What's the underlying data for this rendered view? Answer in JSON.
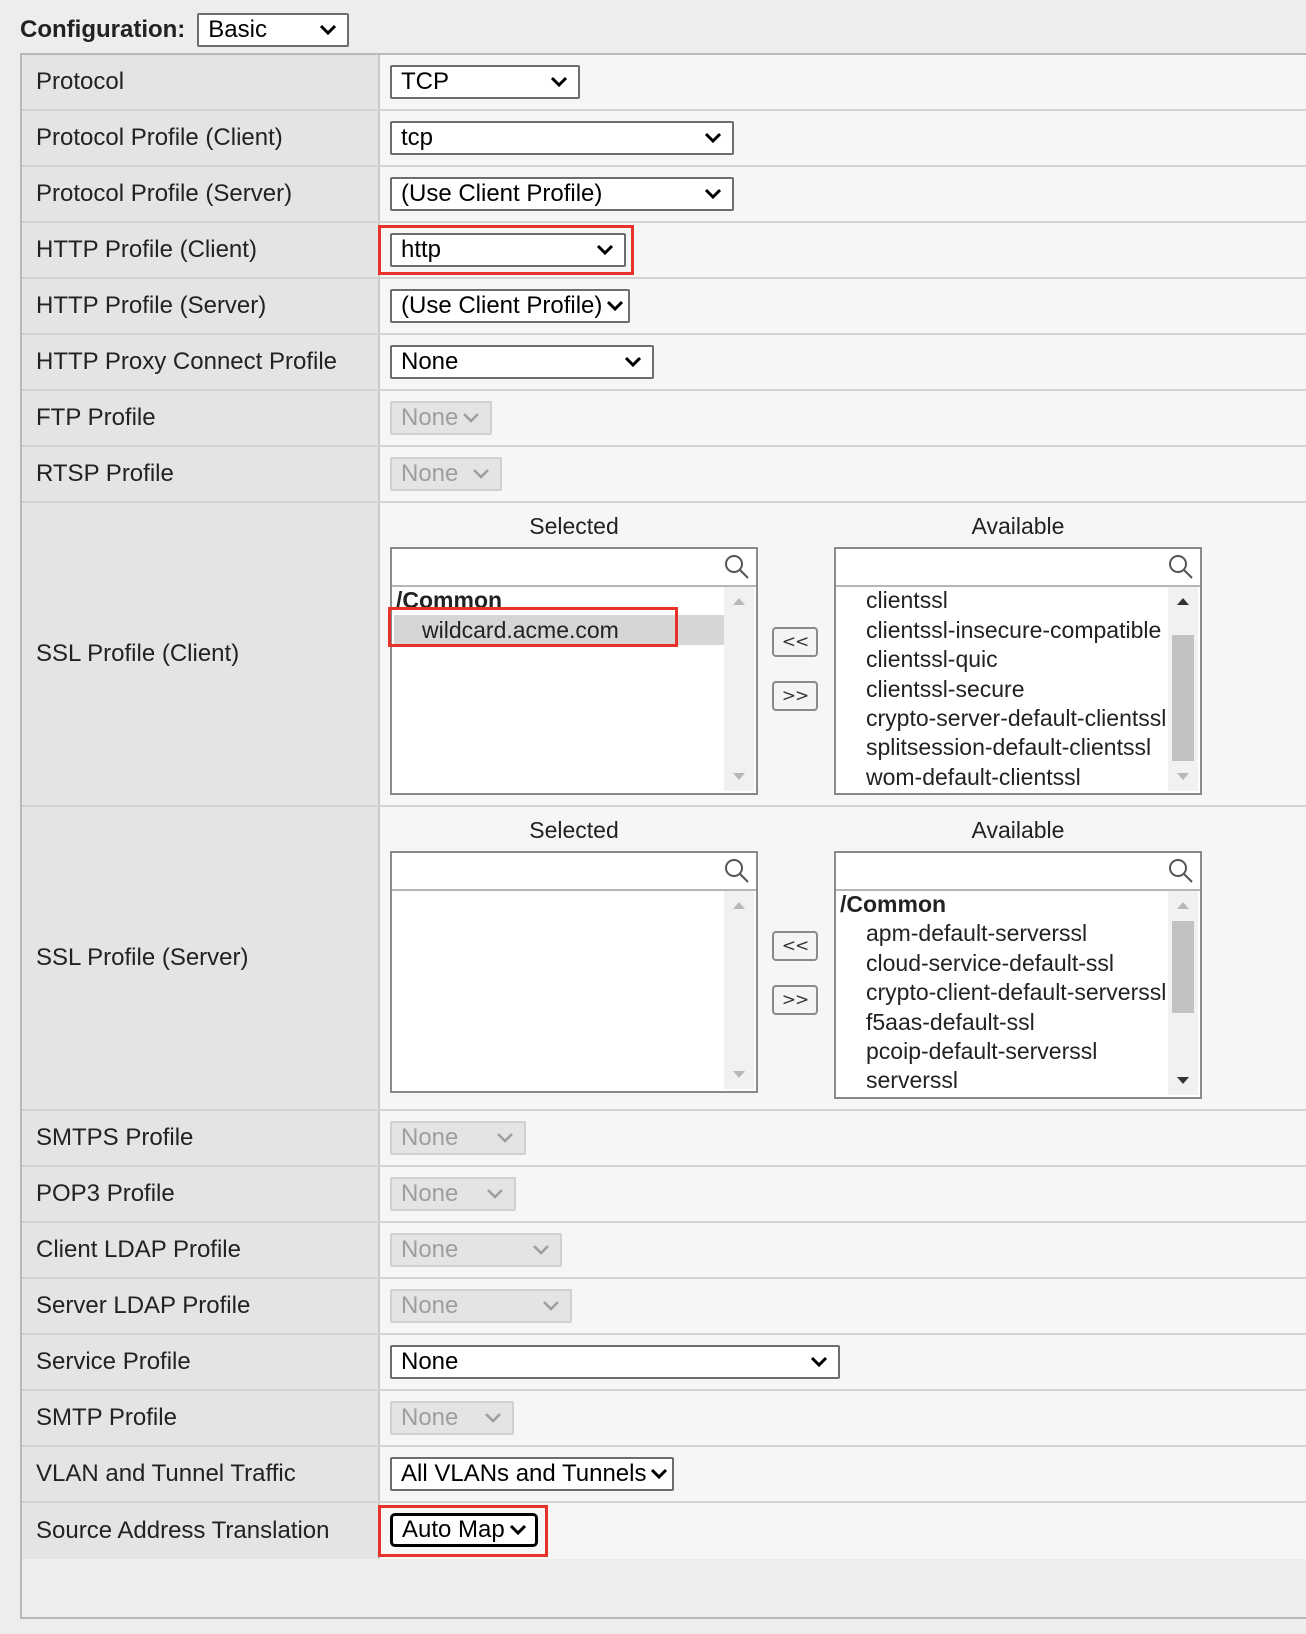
{
  "configuration": {
    "label": "Configuration:",
    "value": "Basic"
  },
  "rows": {
    "protocol": {
      "label": "Protocol",
      "value": "TCP"
    },
    "protocol_profile_client": {
      "label": "Protocol Profile (Client)",
      "value": "tcp"
    },
    "protocol_profile_server": {
      "label": "Protocol Profile (Server)",
      "value": "(Use Client Profile)"
    },
    "http_profile_client": {
      "label": "HTTP Profile (Client)",
      "value": "http"
    },
    "http_profile_server": {
      "label": "HTTP Profile (Server)",
      "value": "(Use Client Profile)"
    },
    "http_proxy_connect_profile": {
      "label": "HTTP Proxy Connect Profile",
      "value": "None"
    },
    "ftp_profile": {
      "label": "FTP Profile",
      "value": "None"
    },
    "rtsp_profile": {
      "label": "RTSP Profile",
      "value": "None"
    },
    "ssl_profile_client": {
      "label": "SSL Profile (Client)",
      "selected_header": "Selected",
      "available_header": "Available",
      "selected_group": "/Common",
      "selected_items": [
        "wildcard.acme.com"
      ],
      "available_items": [
        "clientssl",
        "clientssl-insecure-compatible",
        "clientssl-quic",
        "clientssl-secure",
        "crypto-server-default-clientssl",
        "splitsession-default-clientssl",
        "wom-default-clientssl"
      ],
      "move_left": "<<",
      "move_right": ">>"
    },
    "ssl_profile_server": {
      "label": "SSL Profile (Server)",
      "selected_header": "Selected",
      "available_header": "Available",
      "available_group": "/Common",
      "available_items": [
        "apm-default-serverssl",
        "cloud-service-default-ssl",
        "crypto-client-default-serverssl",
        "f5aas-default-ssl",
        "pcoip-default-serverssl",
        "serverssl"
      ],
      "move_left": "<<",
      "move_right": ">>"
    },
    "smtps_profile": {
      "label": "SMTPS Profile",
      "value": "None"
    },
    "pop3_profile": {
      "label": "POP3 Profile",
      "value": "None"
    },
    "client_ldap_profile": {
      "label": "Client LDAP Profile",
      "value": "None"
    },
    "server_ldap_profile": {
      "label": "Server LDAP Profile",
      "value": "None"
    },
    "service_profile": {
      "label": "Service Profile",
      "value": "None"
    },
    "smtp_profile": {
      "label": "SMTP Profile",
      "value": "None"
    },
    "vlan_tunnel_traffic": {
      "label": "VLAN and Tunnel Traffic",
      "value": "All VLANs and Tunnels"
    },
    "source_address_translation": {
      "label": "Source Address Translation",
      "value": "Auto Map"
    }
  },
  "colors": {
    "highlight": "#e8312a",
    "label_bg": "#e4e4e4",
    "value_bg": "#f6f6f6"
  },
  "icons": {
    "dropdown": "chevron-down-icon",
    "search": "search-icon"
  }
}
